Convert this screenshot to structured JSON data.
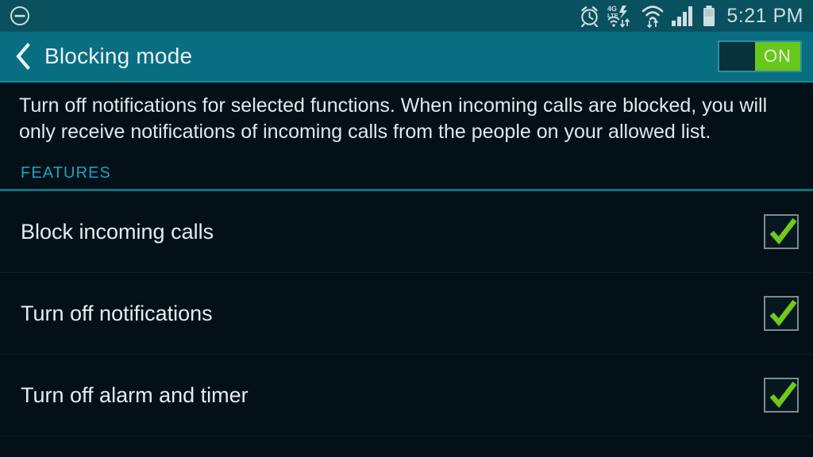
{
  "status_bar": {
    "left_icon": "blocking-mode-circle-minus-icon",
    "icons": [
      "alarm-clock-icon",
      "4g-lte-data-icon",
      "wifi-icon",
      "cellular-signal-icon",
      "battery-icon"
    ],
    "lte_label_top": "4G",
    "lte_label_bottom": "LTE",
    "clock": "5:21 PM",
    "background_color": "#0a5160"
  },
  "app_bar": {
    "back_icon": "back-chevron-icon",
    "title": "Blocking mode",
    "toggle": {
      "label": "ON",
      "state": "on",
      "on_color": "#67c71b"
    },
    "background_color": "#0a6e82"
  },
  "main": {
    "description": "Turn off notifications for selected functions. When incoming calls are blocked, you will only receive notifications of incoming calls from the people on your allowed list.",
    "section_title": "FEATURES",
    "section_color": "#1aa3bd",
    "rows": [
      {
        "label": "Block incoming calls",
        "checked": true
      },
      {
        "label": "Turn off notifications",
        "checked": true
      },
      {
        "label": "Turn off alarm and timer",
        "checked": true
      }
    ],
    "background_color": "#041018",
    "checkmark_color": "#6fc91e"
  }
}
